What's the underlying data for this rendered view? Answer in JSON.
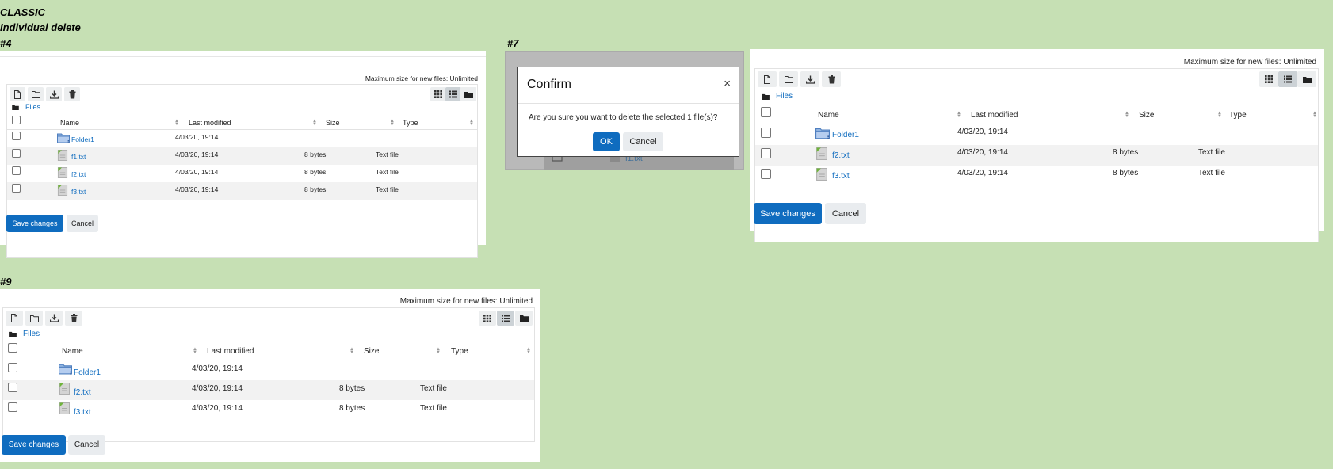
{
  "labels": {
    "theme": "CLASSIC",
    "subtitle": "Individual delete",
    "step4": "#4",
    "step7": "#7",
    "step9": "#9"
  },
  "filepicker": {
    "max_size": "Maximum size for new files: Unlimited",
    "breadcrumb": "Files",
    "col_name": "Name",
    "col_modified": "Last modified",
    "col_size": "Size",
    "col_type": "Type",
    "save_label": "Save changes",
    "cancel_label": "Cancel"
  },
  "files4": [
    {
      "name": "Folder1",
      "modified": "4/03/20, 19:14",
      "size": "",
      "type": "",
      "kind": "folder"
    },
    {
      "name": "f1.txt",
      "modified": "4/03/20, 19:14",
      "size": "8 bytes",
      "type": "Text file",
      "kind": "file"
    },
    {
      "name": "f2.txt",
      "modified": "4/03/20, 19:14",
      "size": "8 bytes",
      "type": "Text file",
      "kind": "file"
    },
    {
      "name": "f3.txt",
      "modified": "4/03/20, 19:14",
      "size": "8 bytes",
      "type": "Text file",
      "kind": "file"
    }
  ],
  "files_after": [
    {
      "name": "Folder1",
      "modified": "4/03/20, 19:14",
      "size": "",
      "type": "",
      "kind": "folder"
    },
    {
      "name": "f2.txt",
      "modified": "4/03/20, 19:14",
      "size": "8 bytes",
      "type": "Text file",
      "kind": "file"
    },
    {
      "name": "f3.txt",
      "modified": "4/03/20, 19:14",
      "size": "8 bytes",
      "type": "Text file",
      "kind": "file"
    }
  ],
  "dialog": {
    "title": "Confirm",
    "close": "×",
    "message": "Are you sure you want to delete the selected 1 file(s)?",
    "ok_label": "OK",
    "cancel_label": "Cancel",
    "behind_filename": "f1.txt"
  }
}
